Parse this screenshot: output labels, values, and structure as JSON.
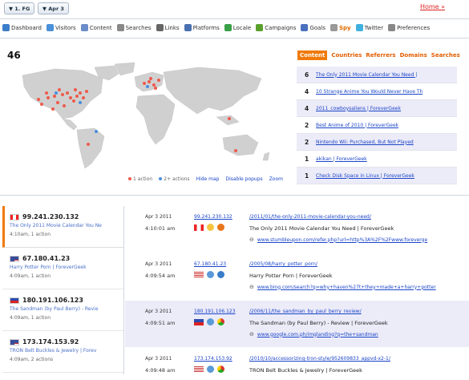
{
  "topbar": {
    "filter_label": "▼ 1. FG",
    "date_label": "▼ Apr 3",
    "home_link": "Home »"
  },
  "nav": [
    {
      "label": "Dashboard",
      "icon": "dashboard-icon",
      "color": "#3a7dc9"
    },
    {
      "label": "Visitors",
      "icon": "visitors-icon",
      "color": "#4a90d9"
    },
    {
      "label": "Content",
      "icon": "content-icon",
      "color": "#6a8cc8"
    },
    {
      "label": "Searches",
      "icon": "search-icon",
      "color": "#888"
    },
    {
      "label": "Links",
      "icon": "links-icon",
      "color": "#666"
    },
    {
      "label": "Platforms",
      "icon": "platforms-icon",
      "color": "#4a6fb0"
    },
    {
      "label": "Locale",
      "icon": "globe-icon",
      "color": "#3aa04a"
    },
    {
      "label": "Campaigns",
      "icon": "campaigns-icon",
      "color": "#5aa02c"
    },
    {
      "label": "Goals",
      "icon": "goals-icon",
      "color": "#4a70c0"
    },
    {
      "label": "Spy",
      "icon": "spy-icon",
      "color": "#999"
    },
    {
      "label": "Twitter",
      "icon": "twitter-icon",
      "color": "#40b0e0"
    },
    {
      "label": "Preferences",
      "icon": "gear-icon",
      "color": "#888"
    }
  ],
  "visitor_count": "46",
  "map_legend": {
    "one_action": "1 action",
    "two_plus_actions": "2+ actions",
    "hide_map": "Hide map",
    "disable_popups": "Disable popups",
    "zoom": "Zoom",
    "one_action_color": "#ef5a4a",
    "two_plus_color": "#4a8ee0"
  },
  "content_tabs": [
    "Content",
    "Countries",
    "Referrers",
    "Domains",
    "Searches"
  ],
  "content_list": [
    {
      "count": "6",
      "title": "The Only 2011 Movie Calendar You Need |"
    },
    {
      "count": "4",
      "title": "10 Strange Anime You Would Never Have Th"
    },
    {
      "count": "4",
      "title": "2011_cowboysaliens | ForeverGeek"
    },
    {
      "count": "2",
      "title": "Best Anime of 2010 | ForeverGeek"
    },
    {
      "count": "2",
      "title": "Nintendo Wii: Purchased, But Not Played"
    },
    {
      "count": "1",
      "title": "akikan | ForeverGeek"
    },
    {
      "count": "1",
      "title": "Check Disk Space in Linux | ForeverGeek"
    }
  ],
  "visitors": [
    {
      "ip": "99.241.230.132",
      "flag": "canada",
      "page": "The Only 2011 Movie Calendar You Ne",
      "meta": "4:10am, 1 action"
    },
    {
      "ip": "67.180.41.23",
      "flag": "usa",
      "page": "Harry Potter Porn | ForeverGeek",
      "meta": "4:09am, 1 action"
    },
    {
      "ip": "180.191.106.123",
      "flag": "philippines",
      "page": "The Sandman (by Paul Berry) - Revie",
      "meta": "4:09am, 1 action"
    },
    {
      "ip": "173.174.153.92",
      "flag": "usa",
      "page": "TRON Belt Buckles & Jewelry | Forev",
      "meta": "4:09am, 2 actions"
    }
  ],
  "details": [
    {
      "date": "Apr 3 2011",
      "time": "4:10:01 am",
      "ip": "99.241.230.132",
      "url": "/2011/01/the-only-2011-movie-calendar-you-need/",
      "title": "The Only 2011 Movie Calendar You Need | ForeverGeek",
      "referrer": "www.stumbleupon.com/refer.php?url=http%3A%2F%2Fwww.foreverge",
      "browser_icons": [
        "canada-flag-icon",
        "linux-icon",
        "firefox-icon"
      ]
    },
    {
      "date": "Apr 3 2011",
      "time": "4:09:54 am",
      "ip": "67.180.41.23",
      "url": "/2005/08/harry_potter_porn/",
      "title": "Harry Potter Porn | ForeverGeek",
      "referrer": "www.bing.com/search?q=why+haven%27t+they+made+a+harry+potter",
      "browser_icons": [
        "usa-flag-icon",
        "windows-icon",
        "ie-icon"
      ]
    },
    {
      "date": "Apr 3 2011",
      "time": "4:09:51 am",
      "ip": "180.191.106.123",
      "url": "/2006/11/the_sandman_by_paul_berry_review/",
      "title": "The Sandman (by Paul Berry) - Review | ForeverGeek",
      "referrer": "www.google.com.ph/imglanding?q=the+sandman",
      "browser_icons": [
        "philippines-flag-icon",
        "windows-icon",
        "chrome-icon"
      ]
    },
    {
      "date": "Apr 3 2011",
      "time": "4:09:48 am",
      "ip": "173.174.153.92",
      "url": "/2010/10/accessorizing-tron-style/952609833_appvd-x2-1/",
      "title": "TRON Belt Buckles & Jewelry | ForeverGeek",
      "referrer": "",
      "browser_icons": [
        "usa-flag-icon",
        "windows-icon",
        "chrome-icon"
      ]
    }
  ]
}
